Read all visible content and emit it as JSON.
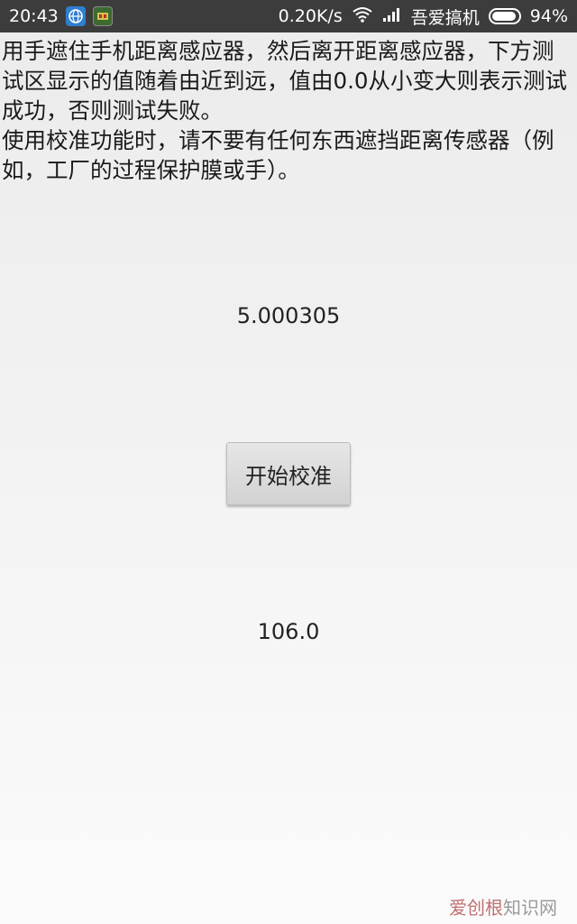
{
  "status_bar": {
    "time": "20:43",
    "network_speed": "0.20K/s",
    "carrier": "吾爱搞机",
    "battery": "94%",
    "battery_level": 0.94,
    "icons": [
      "browser-icon",
      "app-icon",
      "wifi-icon",
      "signal-icon",
      "battery-icon"
    ]
  },
  "instructions": {
    "line1": "用手遮住手机距离感应器，然后离开距离感应器，下方测试区显示的值随着由近到远，值由0.0从小变大则表示测试成功，否则测试失败。",
    "line2": "使用校准功能时，请不要有任何东西遮挡距离传感器（例如，工厂的过程保护膜或手）。"
  },
  "sensor_value": "5.000305",
  "calibrate_button_label": "开始校准",
  "calibration_value": "106.0",
  "watermark": {
    "brand": "爱创根",
    "site": "知识网"
  }
}
